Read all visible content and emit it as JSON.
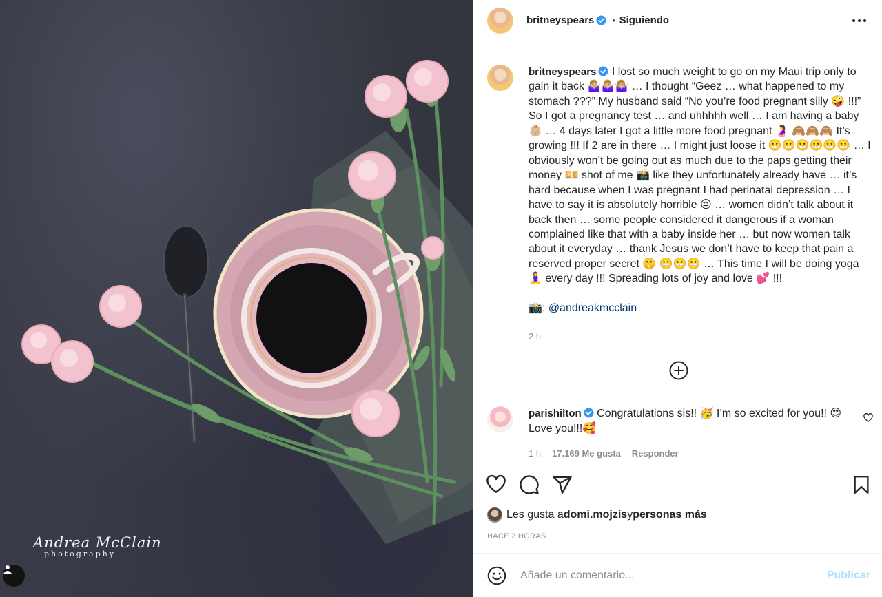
{
  "photo": {
    "watermark_name": "Andrea McClain",
    "watermark_sub": "photography",
    "tag_icon": "user-tag-icon"
  },
  "header": {
    "username": "britneyspears",
    "separator": "•",
    "follow_status": "Siguiendo",
    "more_icon": "more-options-icon"
  },
  "caption": {
    "username": "britneyspears",
    "text": "I lost so much weight to go on my Maui trip only to gain it back 🤷🏼‍♀️🤷🏼‍♀️🤷🏼‍♀️ … I thought “Geez … what happened to my stomach ???” My husband said “No you’re food pregnant silly 🤪 !!!” So I got a pregnancy test … and uhhhhh well … I am having a baby 👶🏼 … 4 days later I got a little more food pregnant 🤰 🙈🙈🙈 It’s growing !!! If 2 are in there … I might just loose it 😬😬😬😬😬😬 … I obviously won’t be going out as much due to the paps getting their money 💴 shot of me 📸 like they unfortunately already have … it’s hard because when I was pregnant I had perinatal depression … I have to say it is absolutely horrible 😔 … women didn’t talk about it back then … some people considered it dangerous if a woman complained like that with a baby inside her … but now women talk about it everyday … thank Jesus we don’t have to keep that pain a reserved proper secret 🤫 😬😬😬 … This time I will be doing yoga 🧘‍♀️ every day !!! Spreading lots of joy and love 💕 !!!",
    "credit_prefix": "📸: ",
    "credit_handle": "@andreakmcclain",
    "time": "2 h"
  },
  "load_more_icon": "plus-circle-icon",
  "comment": {
    "username": "parishilton",
    "text": "Congratulations sis!! 🥳 I’m so excited for you!! 😍 Love you!!!🥰",
    "time": "1 h",
    "likes": "17.169 Me gusta",
    "reply": "Responder"
  },
  "likes": {
    "prefix": "Les gusta a ",
    "user": "domi.mojzis",
    "middle": " y ",
    "others": "personas más"
  },
  "post_age": "HACE 2 HORAS",
  "add_comment": {
    "placeholder": "Añade un comentario...",
    "publish": "Publicar"
  },
  "colors": {
    "verified": "#3897f0",
    "link": "#00376b",
    "publish_disabled": "#b2dffc",
    "muted": "#8e8e8e"
  }
}
